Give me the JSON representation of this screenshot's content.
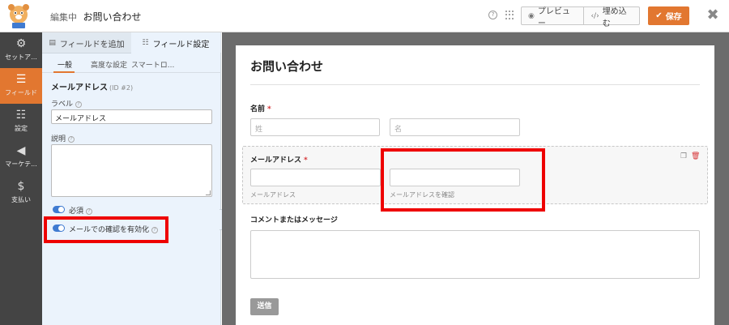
{
  "topbar": {
    "breadcrumb_prefix": "編集中",
    "form_name": "お問い合わせ",
    "help_icon": "question-circle-icon",
    "grid_icon": "dots-grid-icon",
    "preview_label": "プレビュー",
    "embed_label": "埋め込む",
    "save_label": "保存",
    "close_glyph": "✖"
  },
  "nav": {
    "items": [
      {
        "label": "セットア...",
        "icon": "gear-icon",
        "glyph": "⚙"
      },
      {
        "label": "フィールド",
        "icon": "fields-list-icon",
        "glyph": "☰"
      },
      {
        "label": "設定",
        "icon": "sliders-icon",
        "glyph": "☷"
      },
      {
        "label": "マーケテ...",
        "icon": "megaphone-icon",
        "glyph": "📢"
      },
      {
        "label": "支払い",
        "icon": "dollar-icon",
        "glyph": "$"
      }
    ],
    "active_index": 1
  },
  "panel": {
    "tabs": [
      "フィールドを追加",
      "フィールド設定"
    ],
    "active_tab": 1,
    "subtabs": [
      "一般",
      "高度な設定",
      "スマートロ..."
    ],
    "field_name": "メールアドレス",
    "field_id": "(ID #2)",
    "label_caption": "ラベル",
    "label_value": "メールアドレス",
    "description_caption": "説明",
    "required_label": "必須",
    "confirm_label": "メールでの確認を有効化",
    "collapse_glyph": "‹"
  },
  "form": {
    "title": "お問い合わせ",
    "name_label": "名前",
    "required_mark": "*",
    "last_name_placeholder": "姓",
    "first_name_placeholder": "名",
    "email_label": "メールアドレス",
    "email_sublabel": "メールアドレス",
    "confirm_sublabel": "メールアドレスを確認",
    "message_label": "コメントまたはメッセージ",
    "submit_label": "送信"
  },
  "colors": {
    "accent": "#e27730",
    "highlight": "#ee0000",
    "toggle_on": "#3f7bd1",
    "sidebar_bg": "#444444",
    "preview_bg": "#6c6c6c"
  }
}
